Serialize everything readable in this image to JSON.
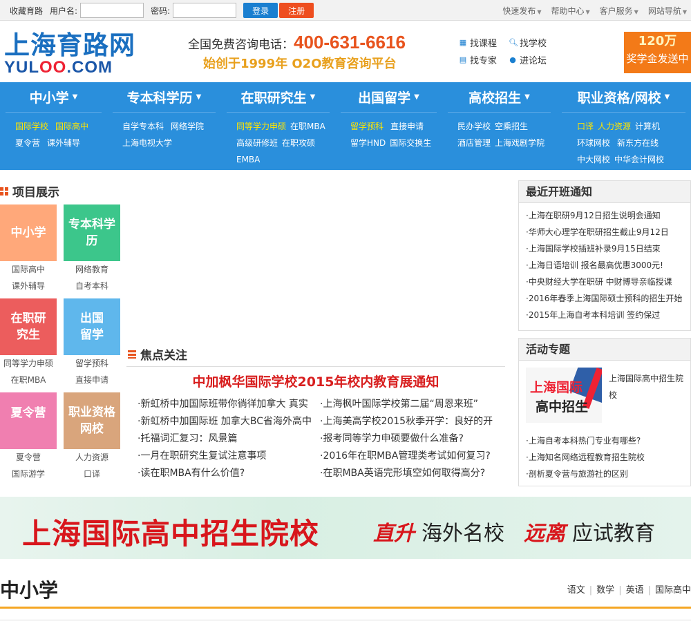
{
  "topbar": {
    "bookmark": "收藏育路",
    "username_label": "用户名:",
    "password_label": "密码:",
    "login": "登录",
    "register": "注册",
    "right": [
      "快速发布",
      "帮助中心",
      "客户服务",
      "网站导航"
    ]
  },
  "header": {
    "logo_cn": "上海育路网",
    "logo_en_a": "YUL",
    "logo_en_oo": "OO",
    "logo_en_b": ".COM",
    "phone_label": "全国免费咨询电话：",
    "phone": "400-631-6616",
    "slogan": "始创于1999年 O2O教育咨询平台",
    "quick": [
      "找课程",
      "找学校",
      "找专家",
      "进论坛"
    ],
    "award_amount": "120万",
    "award_text": "奖学金发送中"
  },
  "nav": [
    {
      "title": "中小学",
      "links": [
        [
          "国际学校",
          "国际高中"
        ],
        [
          "夏令营",
          "课外辅导"
        ]
      ]
    },
    {
      "title": "专本科学历",
      "links": [
        [
          "自学专本科",
          "网络学院"
        ],
        [
          "上海电视大学"
        ]
      ]
    },
    {
      "title": "在职研究生",
      "links": [
        [
          "同等学力申硕",
          "在职MBA"
        ],
        [
          "高级研修班",
          "在职攻硕"
        ],
        [
          "EMBA"
        ]
      ]
    },
    {
      "title": "出国留学",
      "links": [
        [
          "留学预科",
          "直接申请"
        ],
        [
          "留学HND",
          "国际交换生"
        ]
      ]
    },
    {
      "title": "高校招生",
      "links": [
        [
          "民办学校",
          "空乘招生"
        ],
        [
          "酒店管理",
          "上海戏剧学院"
        ]
      ]
    },
    {
      "title": "职业资格/网校",
      "links": [
        [
          "口译",
          "人力资源",
          "计算机"
        ],
        [
          "环球网校",
          "新东方在线"
        ],
        [
          "中大网校",
          "中华会计网校"
        ]
      ]
    }
  ],
  "projects": {
    "title": "项目展示",
    "tiles": [
      {
        "label": "中小学",
        "subs": [
          "国际高中",
          "课外辅导"
        ],
        "color": "#ffa87a"
      },
      {
        "label": "专本科学历",
        "subs": [
          "网络教育",
          "自考本科"
        ],
        "color": "#3cc68b"
      },
      {
        "label": "在职研究生",
        "subs": [
          "同等学力申硕",
          "在职MBA"
        ],
        "color": "#ec5d5d"
      },
      {
        "label": "出国留学",
        "subs": [
          "留学预科",
          "直接申请"
        ],
        "color": "#5fb7ec"
      },
      {
        "label": "夏令营",
        "subs": [
          "夏令营",
          "国际游学"
        ],
        "color": "#f07fb0"
      },
      {
        "label": "职业资格网校",
        "subs": [
          "人力资源",
          "口译"
        ],
        "color": "#d9a57c"
      }
    ]
  },
  "focus": {
    "title": "焦点关注",
    "headline": "中加枫华国际学校2015年校内教育展通知",
    "left": [
      "新虹桥中加国际班带你徜徉加拿大 真实",
      "新虹桥中加国际班 加拿大BC省海外高中",
      "托福词汇复习：风景篇",
      "一月在职研究生复试注意事项",
      "读在职MBA有什么价值?"
    ],
    "right": [
      "上海枫叶国际学校第二届“周恩来班”",
      "上海美高学校2015秋季开学：良好的开",
      "报考同等学力申硕要做什么准备?",
      "2016年在职MBA管理类考试如何复习?",
      "在职MBA英语完形填空如何取得高分?"
    ]
  },
  "notices": {
    "title": "最近开班通知",
    "items": [
      "上海在职研9月12日招生说明会通知",
      "华师大心理学在职研招生截止9月12日",
      "上海国际学校插班补录9月15日结束",
      "上海日语培训 报名最高优惠3000元!",
      "中央财经大学在职研 中财博导亲临授课",
      "2016年春季上海国际硕士预科的招生开始",
      "2015年上海自考本科培训 签约保过"
    ]
  },
  "events": {
    "title": "活动专题",
    "promo_img_line1": "上海国际",
    "promo_img_line2": "高中招生",
    "promo_text": "上海国际高中招生院校",
    "items": [
      "上海自考本科热门专业有哪些?",
      "上海知名网络远程教育招生院校",
      "剖析夏令营与旅游社的区别"
    ]
  },
  "banner": {
    "main": "上海国际高中招生院校",
    "k1": "直升",
    "t1": "海外名校",
    "k2": "远离",
    "t2": "应试教育"
  },
  "section2": {
    "title": "中小学",
    "links": [
      "语文",
      "数学",
      "英语",
      "国际高中"
    ]
  }
}
